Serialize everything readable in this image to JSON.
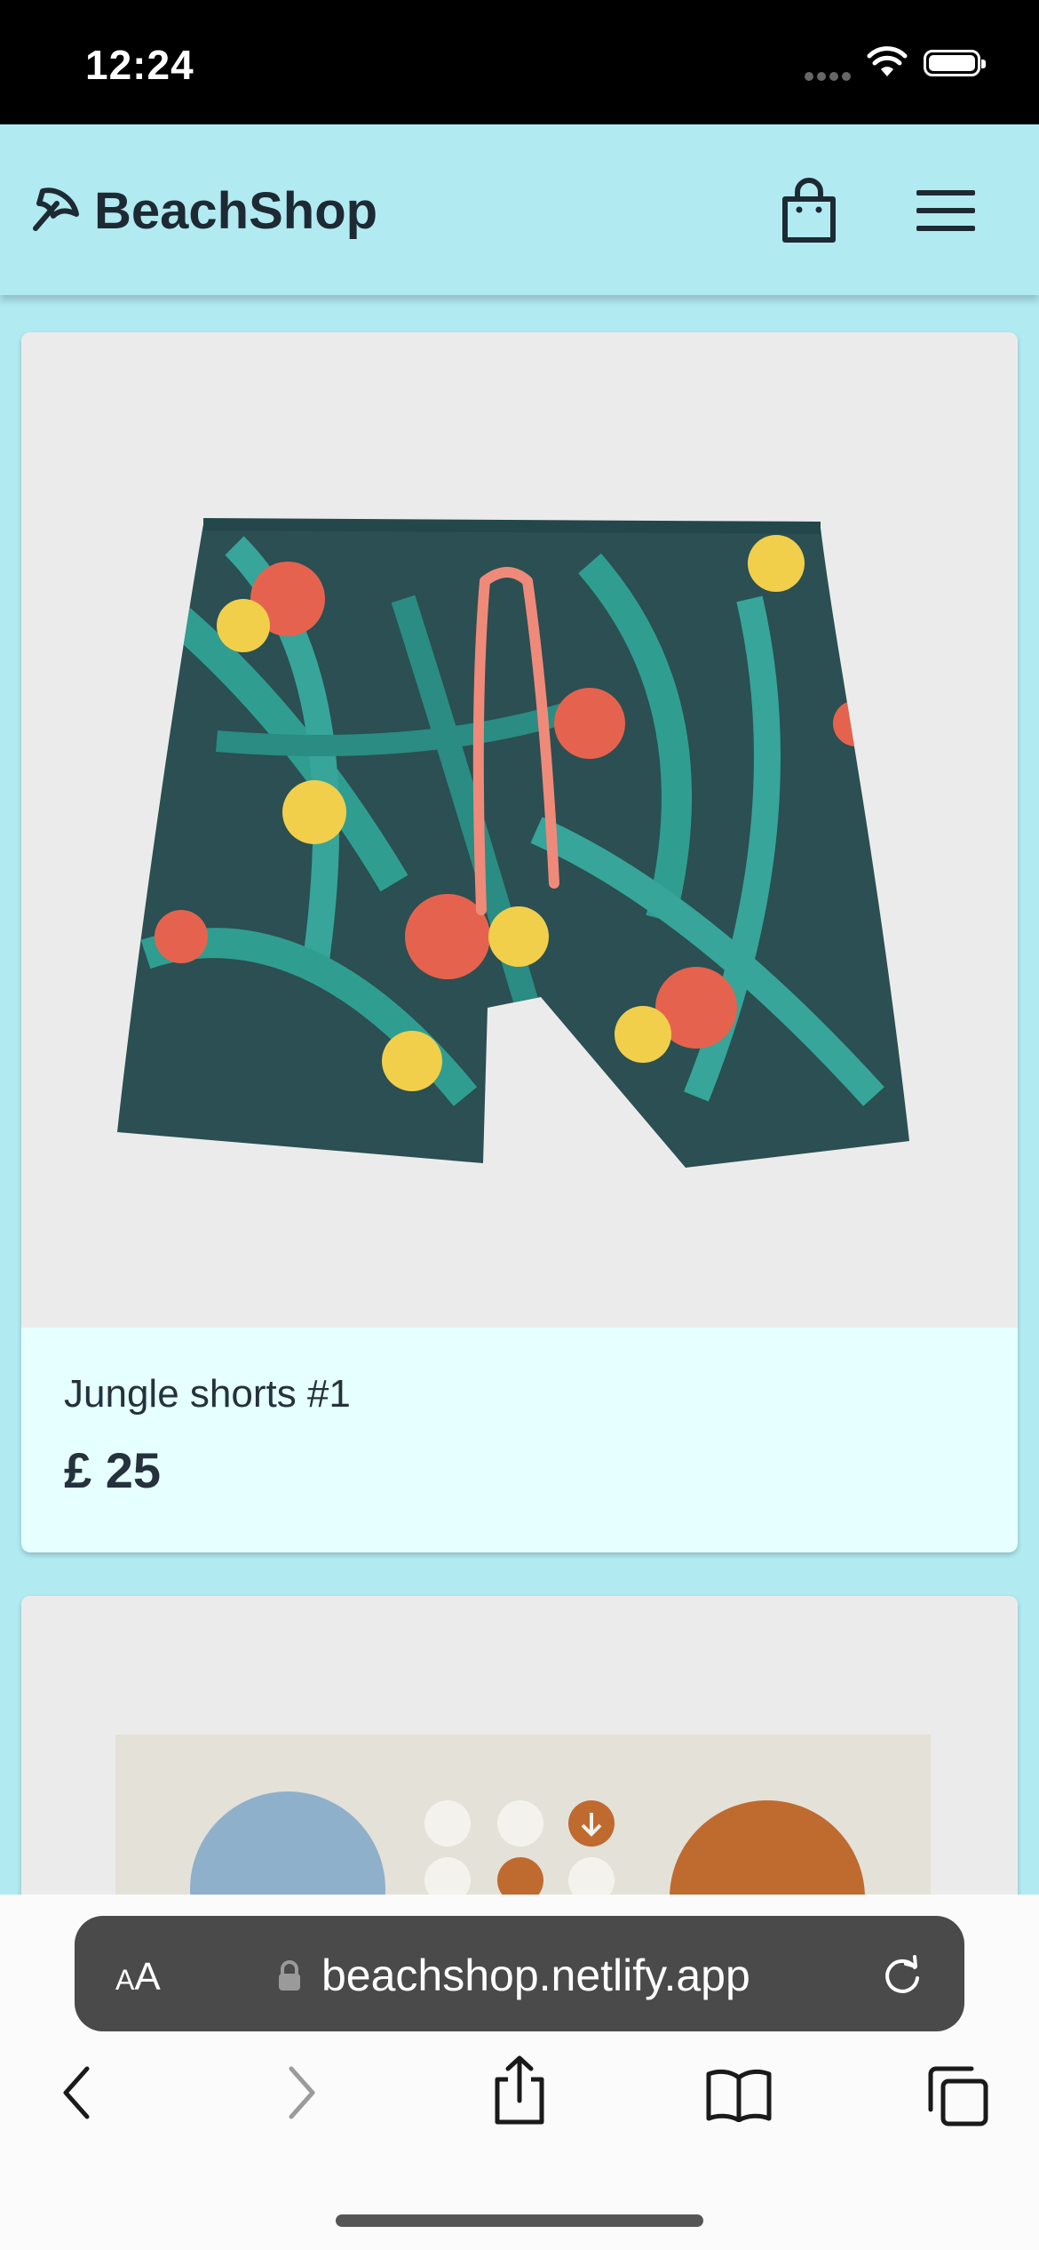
{
  "status_bar": {
    "time": "12:24"
  },
  "header": {
    "brand": "BeachShop"
  },
  "products": [
    {
      "title": "Jungle shorts #1",
      "price": "£ 25"
    }
  ],
  "browser": {
    "aa_small": "A",
    "aa_large": "A",
    "url": "beachshop.netlify.app"
  }
}
